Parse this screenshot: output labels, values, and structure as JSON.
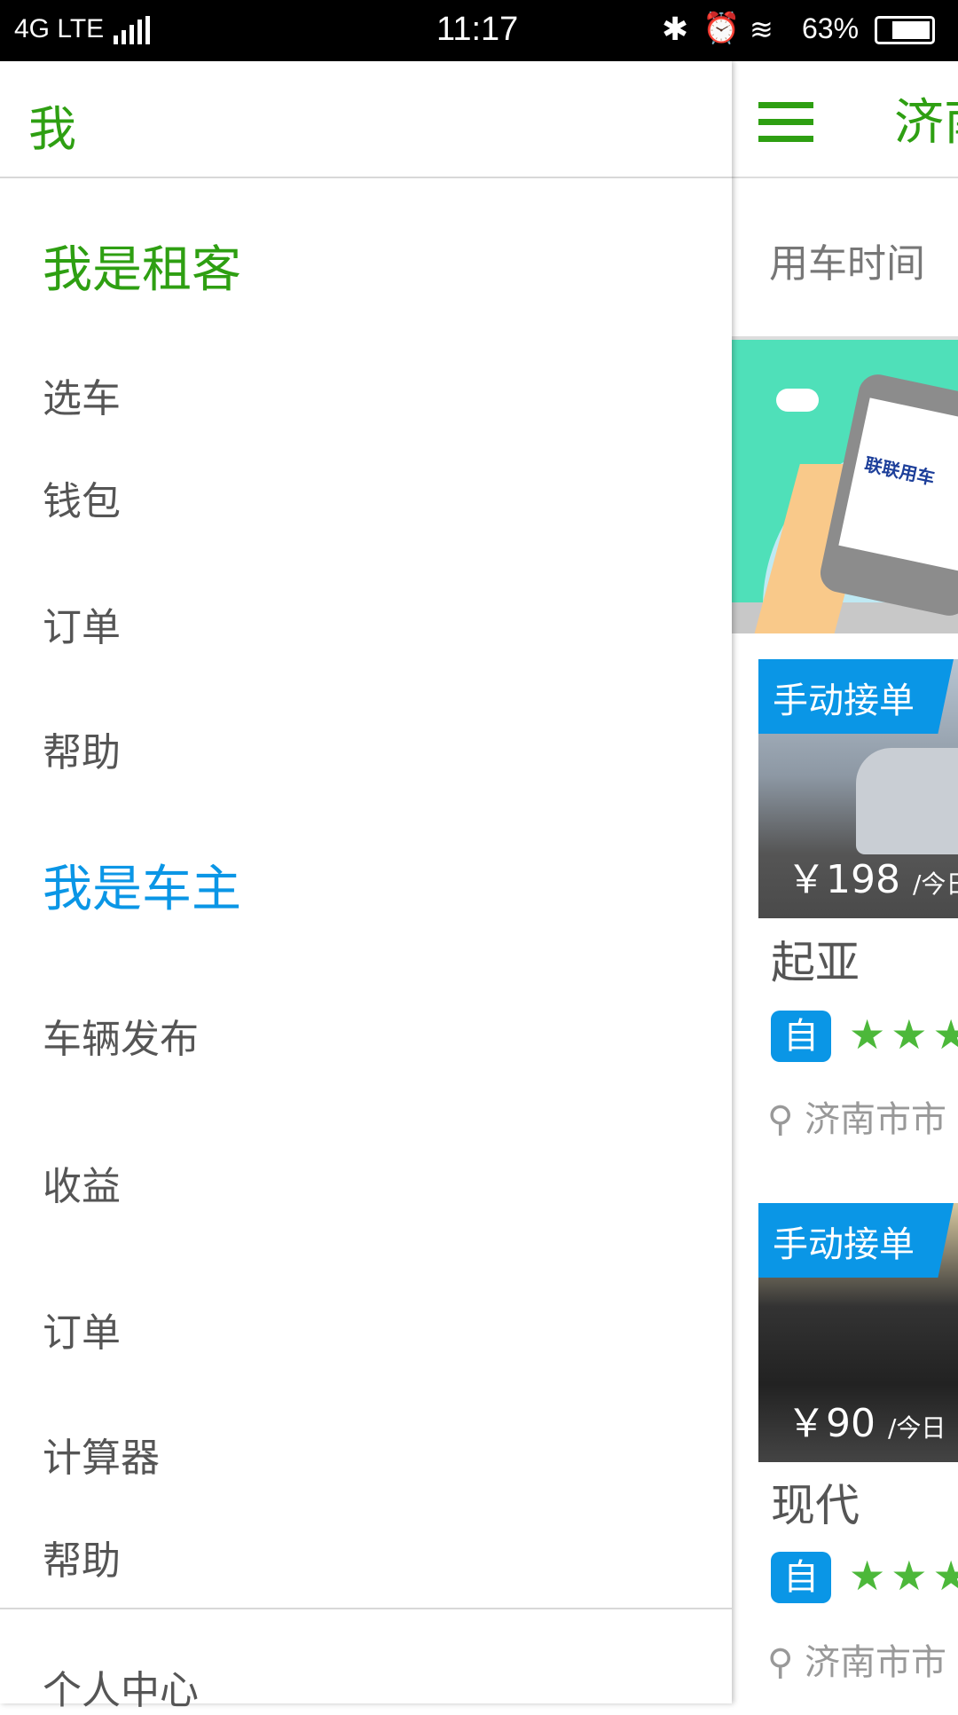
{
  "status_bar": {
    "network": "4G LTE",
    "time": "11:17",
    "battery": "63%"
  },
  "drawer": {
    "title": "我",
    "renter_section": "我是租客",
    "renter_items": [
      "选车",
      "钱包",
      "订单",
      "帮助"
    ],
    "owner_section": "我是车主",
    "owner_items": [
      "车辆发布",
      "收益",
      "订单",
      "计算器",
      "帮助"
    ],
    "personal_center": "个人中心"
  },
  "main": {
    "city": "济南",
    "time_label": "用车时间",
    "banner_logo": "联联用车",
    "cars": [
      {
        "tag": "手动接单",
        "price": "￥198",
        "price_unit": "/今日",
        "name": "起亚",
        "badge": "自",
        "location": "济南市市"
      },
      {
        "tag": "手动接单",
        "price": "￥90",
        "price_unit": "/今日",
        "name": "现代",
        "badge": "自",
        "location": "济南市市"
      }
    ]
  },
  "colors": {
    "green": "#2e9f12",
    "blue": "#0a96e6",
    "star": "#4cb83a",
    "banner": "#4fe0b9"
  }
}
